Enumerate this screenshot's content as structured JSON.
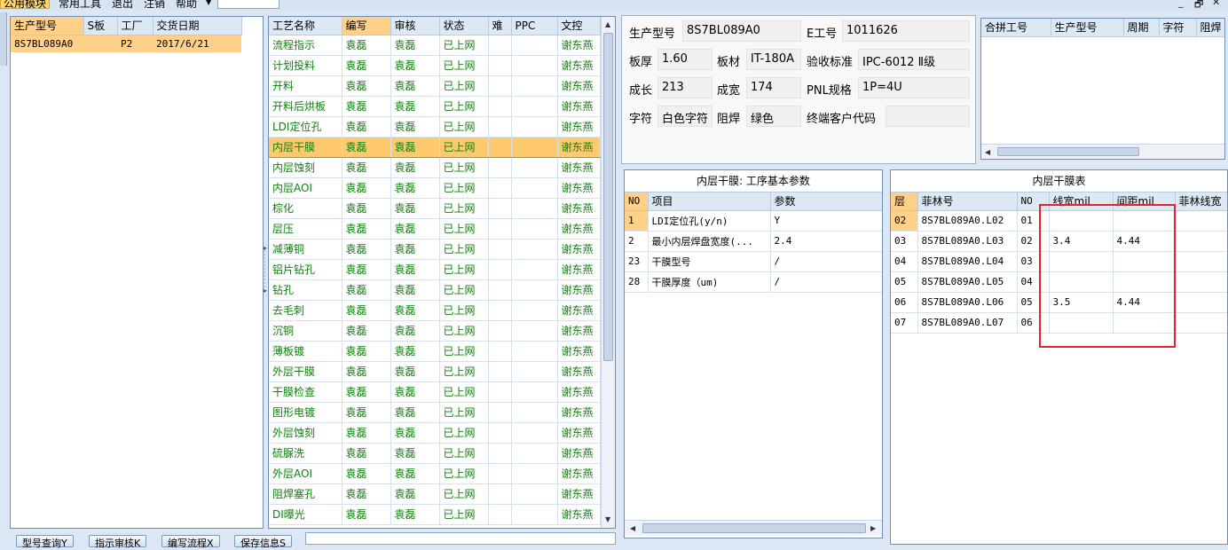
{
  "menu": {
    "items": [
      "公用模块",
      "常用工具",
      "退出",
      "注销",
      "帮助"
    ],
    "window_controls": [
      "_",
      "🗗",
      "✕"
    ]
  },
  "left_grid": {
    "columns": [
      "生产型号",
      "S板",
      "工厂",
      "交货日期"
    ],
    "rows": [
      {
        "model": "8S7BL089A0",
        "s": "",
        "factory": "P2",
        "date": "2017/6/21"
      }
    ]
  },
  "process_grid": {
    "columns": [
      "工艺名称",
      "编写",
      "审核",
      "状态",
      "难",
      "PPC",
      "文控"
    ],
    "rows": [
      {
        "name": "流程指示",
        "author": "袁磊",
        "reviewer": "袁磊",
        "status": "已上网",
        "hard": "",
        "ppc": "",
        "doc": "谢东燕"
      },
      {
        "name": "计划投料",
        "author": "袁磊",
        "reviewer": "袁磊",
        "status": "已上网",
        "hard": "",
        "ppc": "",
        "doc": "谢东燕"
      },
      {
        "name": "开料",
        "author": "袁磊",
        "reviewer": "袁磊",
        "status": "已上网",
        "hard": "",
        "ppc": "",
        "doc": "谢东燕"
      },
      {
        "name": "开料后烘板",
        "author": "袁磊",
        "reviewer": "袁磊",
        "status": "已上网",
        "hard": "",
        "ppc": "",
        "doc": "谢东燕"
      },
      {
        "name": "LDI定位孔",
        "author": "袁磊",
        "reviewer": "袁磊",
        "status": "已上网",
        "hard": "",
        "ppc": "",
        "doc": "谢东燕"
      },
      {
        "name": "内层干膜",
        "author": "袁磊",
        "reviewer": "袁磊",
        "status": "已上网",
        "hard": "",
        "ppc": "",
        "doc": "谢东燕"
      },
      {
        "name": "内层蚀刻",
        "author": "袁磊",
        "reviewer": "袁磊",
        "status": "已上网",
        "hard": "",
        "ppc": "",
        "doc": "谢东燕"
      },
      {
        "name": "内层AOI",
        "author": "袁磊",
        "reviewer": "袁磊",
        "status": "已上网",
        "hard": "",
        "ppc": "",
        "doc": "谢东燕"
      },
      {
        "name": "棕化",
        "author": "袁磊",
        "reviewer": "袁磊",
        "status": "已上网",
        "hard": "",
        "ppc": "",
        "doc": "谢东燕"
      },
      {
        "name": "层压",
        "author": "袁磊",
        "reviewer": "袁磊",
        "status": "已上网",
        "hard": "",
        "ppc": "",
        "doc": "谢东燕"
      },
      {
        "name": "减薄铜",
        "author": "袁磊",
        "reviewer": "袁磊",
        "status": "已上网",
        "hard": "",
        "ppc": "",
        "doc": "谢东燕"
      },
      {
        "name": "铝片钻孔",
        "author": "袁磊",
        "reviewer": "袁磊",
        "status": "已上网",
        "hard": "",
        "ppc": "",
        "doc": "谢东燕"
      },
      {
        "name": "钻孔",
        "author": "袁磊",
        "reviewer": "袁磊",
        "status": "已上网",
        "hard": "",
        "ppc": "",
        "doc": "谢东燕"
      },
      {
        "name": "去毛刺",
        "author": "袁磊",
        "reviewer": "袁磊",
        "status": "已上网",
        "hard": "",
        "ppc": "",
        "doc": "谢东燕"
      },
      {
        "name": "沉铜",
        "author": "袁磊",
        "reviewer": "袁磊",
        "status": "已上网",
        "hard": "",
        "ppc": "",
        "doc": "谢东燕"
      },
      {
        "name": "薄板镀",
        "author": "袁磊",
        "reviewer": "袁磊",
        "status": "已上网",
        "hard": "",
        "ppc": "",
        "doc": "谢东燕"
      },
      {
        "name": "外层干膜",
        "author": "袁磊",
        "reviewer": "袁磊",
        "status": "已上网",
        "hard": "",
        "ppc": "",
        "doc": "谢东燕"
      },
      {
        "name": "干膜检查",
        "author": "袁磊",
        "reviewer": "袁磊",
        "status": "已上网",
        "hard": "",
        "ppc": "",
        "doc": "谢东燕"
      },
      {
        "name": "图形电镀",
        "author": "袁磊",
        "reviewer": "袁磊",
        "status": "已上网",
        "hard": "",
        "ppc": "",
        "doc": "谢东燕"
      },
      {
        "name": "外层蚀刻",
        "author": "袁磊",
        "reviewer": "袁磊",
        "status": "已上网",
        "hard": "",
        "ppc": "",
        "doc": "谢东燕"
      },
      {
        "name": "硫脲洗",
        "author": "袁磊",
        "reviewer": "袁磊",
        "status": "已上网",
        "hard": "",
        "ppc": "",
        "doc": "谢东燕"
      },
      {
        "name": "外层AOI",
        "author": "袁磊",
        "reviewer": "袁磊",
        "status": "已上网",
        "hard": "",
        "ppc": "",
        "doc": "谢东燕"
      },
      {
        "name": "阻焊塞孔",
        "author": "袁磊",
        "reviewer": "袁磊",
        "status": "已上网",
        "hard": "",
        "ppc": "",
        "doc": "谢东燕"
      },
      {
        "name": "DI曝光",
        "author": "袁磊",
        "reviewer": "袁磊",
        "status": "已上网",
        "hard": "",
        "ppc": "",
        "doc": "谢东燕"
      }
    ]
  },
  "info": {
    "model_label": "生产型号",
    "model": "8S7BL089A0",
    "eno_label": "E工号",
    "eno": "1011626",
    "thick_label": "板厚",
    "thick": "1.60",
    "material_label": "板材",
    "material": "IT-180A",
    "std_label": "验收标准",
    "std": "IPC-6012 Ⅱ级",
    "len_label": "成长",
    "len": "213",
    "width_label": "成宽",
    "width": "174",
    "pnl_label": "PNL规格",
    "pnl": "1P=4U",
    "char_label": "字符",
    "char": "白色字符",
    "mask_label": "阻焊",
    "mask": "绿色",
    "cust_label": "终端客户代码",
    "cust": ""
  },
  "merge_grid": {
    "columns": [
      "合拼工号",
      "生产型号",
      "周期",
      "字符",
      "阻焊"
    ]
  },
  "params": {
    "title": "内层干膜: 工序基本参数",
    "columns": [
      "NO",
      "项目",
      "参数"
    ],
    "rows": [
      {
        "no": "1",
        "item": "LDI定位孔(y/n)",
        "value": "Y"
      },
      {
        "no": "2",
        "item": "最小内层焊盘宽度(...",
        "value": "2.4"
      },
      {
        "no": "23",
        "item": "干膜型号",
        "value": "/"
      },
      {
        "no": "28",
        "item": "干膜厚度（um)",
        "value": "/"
      }
    ]
  },
  "film": {
    "title": "内层干膜表",
    "columns": [
      "层",
      "菲林号",
      "NO",
      "线宽mil",
      "间距mil",
      "菲林线宽"
    ],
    "rows": [
      {
        "layer": "02",
        "film": "8S7BL089A0.L02",
        "no": "01",
        "lw": "",
        "sp": "",
        "flw": ""
      },
      {
        "layer": "03",
        "film": "8S7BL089A0.L03",
        "no": "02",
        "lw": "3.4",
        "sp": "4.44",
        "flw": ""
      },
      {
        "layer": "04",
        "film": "8S7BL089A0.L04",
        "no": "03",
        "lw": "",
        "sp": "",
        "flw": ""
      },
      {
        "layer": "05",
        "film": "8S7BL089A0.L05",
        "no": "04",
        "lw": "",
        "sp": "",
        "flw": ""
      },
      {
        "layer": "06",
        "film": "8S7BL089A0.L06",
        "no": "05",
        "lw": "3.5",
        "sp": "4.44",
        "flw": ""
      },
      {
        "layer": "07",
        "film": "8S7BL089A0.L07",
        "no": "06",
        "lw": "",
        "sp": "",
        "flw": ""
      }
    ]
  },
  "buttons": [
    "型号查询Y",
    "指示审核K",
    "编写流程X",
    "保存信息S"
  ],
  "colors": {
    "selection": "#ffca6e",
    "green_text": "#107a10",
    "highlight_box": "#e0242b"
  }
}
